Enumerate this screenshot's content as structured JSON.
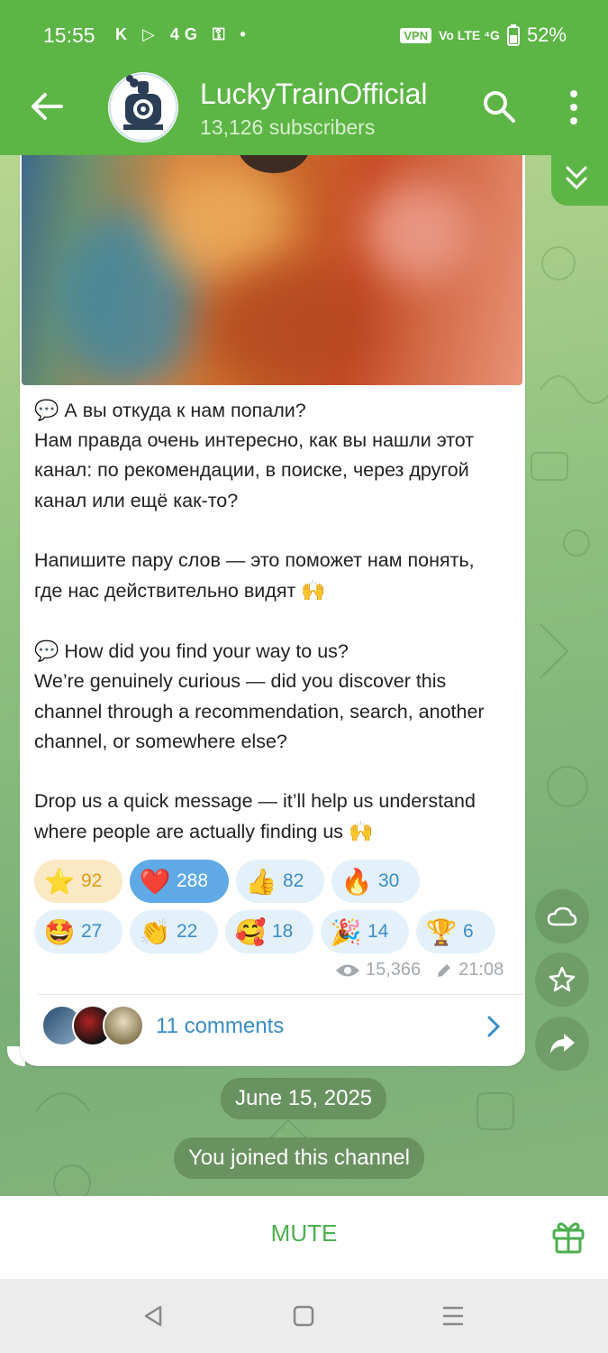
{
  "status_bar": {
    "time": "15:55",
    "left_icons": "K ▷ 4G ⚿ •",
    "vpn": "VPN",
    "network": "Vo LTE ⁴G",
    "battery": "52%"
  },
  "header": {
    "channel_name": "LuckyTrainOfficial",
    "subscribers": "13,126 subscribers",
    "accent_color": "#5cb545"
  },
  "message": {
    "ru_heading": "А вы откуда к нам попали?",
    "ru_body": "Нам правда очень интересно, как вы нашли этот\nканал: по рекомендации, в поиске, через другой\nканал или ещё как-то?",
    "ru_cta": "Напишите пару слов — это поможет нам понять,\nгде нас действительно видят",
    "en_heading": "How did you find your way to us?",
    "en_body": "We’re genuinely curious — did you discover this\nchannel through a recommendation, search, another\nchannel, or somewhere else?",
    "en_cta": "Drop us a quick message — it’ll help us understand\nwhere people are actually finding us",
    "speech_icon": "💬",
    "hands_icon": "🙌",
    "views": "15,366",
    "edited_time": "21:08"
  },
  "reactions": [
    {
      "emoji": "⭐",
      "count": "92"
    },
    {
      "emoji": "❤️",
      "count": "288"
    },
    {
      "emoji": "👍",
      "count": "82"
    },
    {
      "emoji": "🔥",
      "count": "30"
    },
    {
      "emoji": "🤩",
      "count": "27"
    },
    {
      "emoji": "👏",
      "count": "22"
    },
    {
      "emoji": "🥰",
      "count": "18"
    },
    {
      "emoji": "🎉",
      "count": "14"
    },
    {
      "emoji": "🏆",
      "count": "6"
    }
  ],
  "comments": {
    "label": "11 comments"
  },
  "service": {
    "date": "June 15, 2025",
    "joined": "You joined this channel"
  },
  "bottom": {
    "mute_label": "MUTE"
  }
}
